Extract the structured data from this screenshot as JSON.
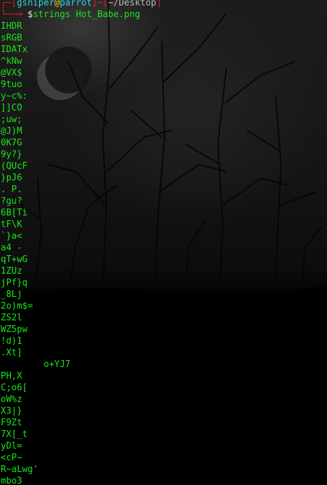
{
  "terminal": {
    "user": "gsniper",
    "at": "@",
    "host": "parrot",
    "path": "~/Desktop",
    "prompt_symbol": "$",
    "command": "strings Hot_Babe.png"
  },
  "output_lines": [
    "IHDR",
    "sRGB",
    "IDATx",
    "^kNw",
    "@VX$",
    "9tuo",
    "y~c%:",
    "]]CO",
    ";uw;",
    "@J)M",
    "0K7G",
    "9y?}",
    "(QUcF",
    "}pJ6",
    ". P.",
    "?gu?",
    "6B[Ti",
    "tF\\K",
    "`}a<",
    "a4 -",
    "qT+wG",
    "1ZUz",
    "jPf}q",
    "_8Lj",
    "2o)m$=",
    "ZS2l",
    "WZ5pw",
    "!d)1",
    ".Xt]",
    "\to+YJ7",
    "PH,X",
    "C;o6[",
    "oW%z",
    "X3|}",
    "F9Zt",
    "7X[_t",
    "yDl=",
    "<cP~",
    "R~aLwg'",
    "mbo3"
  ],
  "colors": {
    "output_text": "#19e619",
    "prompt_bracket": "#e11d1d",
    "user": "#2fd6e0",
    "at_sign": "#ffd400",
    "host": "#2fd6e0",
    "background": "#000000"
  }
}
